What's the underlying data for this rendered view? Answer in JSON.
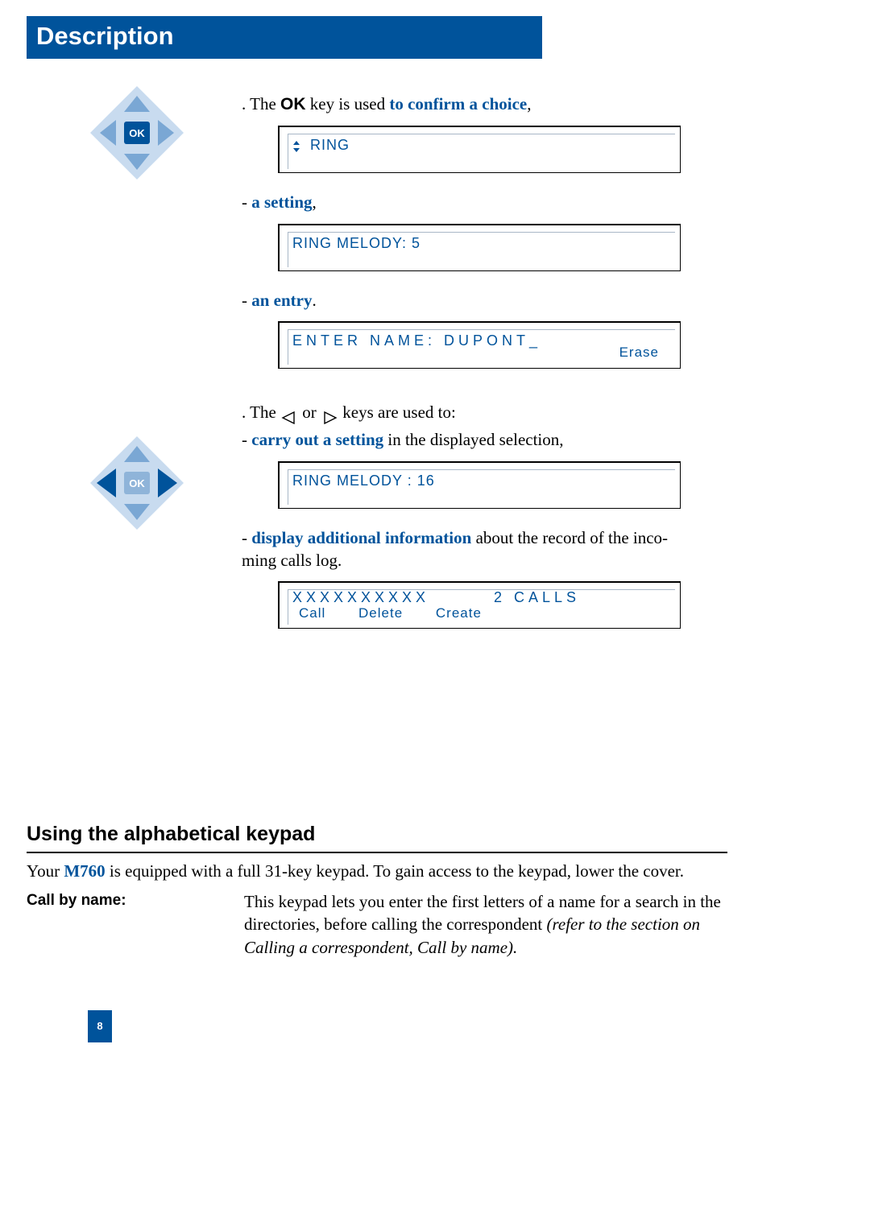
{
  "header": {
    "title": "Description"
  },
  "page_number": "8",
  "ok_sentence": {
    "pre": ". The ",
    "ok": "OK",
    "mid": " key is used ",
    "emph": "to confirm a choice",
    "post": ","
  },
  "lcd1": {
    "text": "RING"
  },
  "setting_label": "a setting",
  "lcd2": {
    "text": "RING MELODY:  5"
  },
  "entry_label": "an entry",
  "lcd3": {
    "text": "ENTER NAME: DUPONT_",
    "right": "Erase"
  },
  "lr_sentence": {
    "pre": ". The ",
    "mid": " or ",
    "post": " keys are used to:"
  },
  "carry_label": "carry out a setting",
  "carry_tail": " in the displayed selection,",
  "lcd4": {
    "text": "RING MELODY :  16"
  },
  "info_label": "display additional information",
  "info_tail_a": " about the record of the inco-",
  "info_tail_b": "ming calls log.",
  "lcd5": {
    "col1": "XXXXXXXXXX",
    "col2": "2 CALLS",
    "b1": "Call",
    "b2": "Delete",
    "b3": "Create"
  },
  "section2": {
    "heading": "Using the alphabetical keypad",
    "intro_pre": "Your ",
    "model": "M760",
    "intro_post": " is equipped with a full 31-key keypad. To gain access to the keypad, lower the cover.",
    "row_label": "Call by name:",
    "row_text_a": "This keypad lets you enter the first letters of a name for a search in the directories, before calling the correspondent ",
    "row_text_ital": "(refer to the section on Calling a correspondent, Call by name)."
  }
}
